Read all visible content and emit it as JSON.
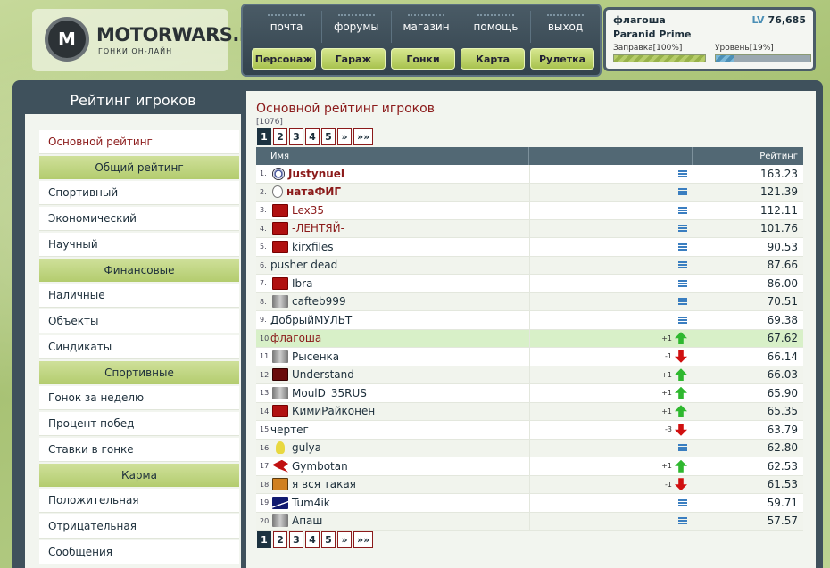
{
  "logo": {
    "name": "MOTORWARS.RU",
    "sub": "ГОНКИ ОН-ЛАЙН",
    "emblem": "M"
  },
  "topnav": [
    "почта",
    "форумы",
    "магазин",
    "помощь",
    "выход"
  ],
  "botnav": [
    "Персонаж",
    "Гараж",
    "Гонки",
    "Карта",
    "Рулетка"
  ],
  "user": {
    "name": "флагоша",
    "lv_label": "LV",
    "lv_value": "76,685",
    "car": "Paranid Prime",
    "fuel_label": "Заправка[100%]",
    "level_label": "Уровень[19%]",
    "fuel_fill": 1.0,
    "level_fill": 0.19
  },
  "sidebar": {
    "title": "Рейтинг игроков",
    "items": [
      {
        "type": "item",
        "label": "Основной рейтинг",
        "active": true
      },
      {
        "type": "head",
        "label": "Общий рейтинг"
      },
      {
        "type": "item",
        "label": "Спортивный"
      },
      {
        "type": "item",
        "label": "Экономический"
      },
      {
        "type": "item",
        "label": "Научный"
      },
      {
        "type": "head",
        "label": "Финансовые"
      },
      {
        "type": "item",
        "label": "Наличные"
      },
      {
        "type": "item",
        "label": "Объекты"
      },
      {
        "type": "item",
        "label": "Синдикаты"
      },
      {
        "type": "head",
        "label": "Спортивные"
      },
      {
        "type": "item",
        "label": "Гонок за неделю"
      },
      {
        "type": "item",
        "label": "Процент побед"
      },
      {
        "type": "item",
        "label": "Ставки в гонке"
      },
      {
        "type": "head",
        "label": "Карма"
      },
      {
        "type": "item",
        "label": "Положительная"
      },
      {
        "type": "item",
        "label": "Отрицательная"
      },
      {
        "type": "item",
        "label": "Сообщения"
      }
    ]
  },
  "content": {
    "title": "Основной рейтинг игроков",
    "count": "[1076]",
    "pager": [
      "1",
      "2",
      "3",
      "4",
      "5",
      "»",
      "»»"
    ],
    "columns": {
      "name": "Имя",
      "rating": "Рейтинг"
    },
    "rows": [
      {
        "rank": "1.",
        "avatar": "wheel",
        "name": "Justynuel",
        "red": true,
        "bold": true,
        "trend": "stat",
        "delta": "",
        "rating": "163.23"
      },
      {
        "rank": "2.",
        "avatar": "ring",
        "name": "натаФИГ",
        "red": true,
        "bold": true,
        "trend": "stat",
        "delta": "",
        "rating": "121.39"
      },
      {
        "rank": "3.",
        "avatar": "flag",
        "name": "Lex35",
        "red": true,
        "bold": false,
        "trend": "stat",
        "delta": "",
        "rating": "112.11"
      },
      {
        "rank": "4.",
        "avatar": "flag",
        "name": "-ЛЕНТЯЙ-",
        "red": true,
        "bold": false,
        "trend": "stat",
        "delta": "",
        "rating": "101.76"
      },
      {
        "rank": "5.",
        "avatar": "flag",
        "name": "kirxfiles",
        "red": false,
        "bold": false,
        "trend": "stat",
        "delta": "",
        "rating": "90.53"
      },
      {
        "rank": "6.",
        "avatar": "",
        "name": "pusher dead",
        "red": false,
        "bold": false,
        "trend": "stat",
        "delta": "",
        "rating": "87.66"
      },
      {
        "rank": "7.",
        "avatar": "flag",
        "name": "Ibra",
        "red": false,
        "bold": false,
        "trend": "stat",
        "delta": "",
        "rating": "86.00"
      },
      {
        "rank": "8.",
        "avatar": "gray",
        "name": "cafteb999",
        "red": false,
        "bold": false,
        "trend": "stat",
        "delta": "",
        "rating": "70.51"
      },
      {
        "rank": "9.",
        "avatar": "",
        "name": "ДобрыйМУЛЬТ",
        "red": false,
        "bold": false,
        "trend": "stat",
        "delta": "",
        "rating": "69.38"
      },
      {
        "rank": "10.",
        "avatar": "",
        "name": "флагоша",
        "red": true,
        "bold": false,
        "trend": "up",
        "delta": "+1",
        "rating": "67.62",
        "me": true
      },
      {
        "rank": "11.",
        "avatar": "gray",
        "name": "Рысенка",
        "red": false,
        "bold": false,
        "trend": "down",
        "delta": "-1",
        "rating": "66.14"
      },
      {
        "rank": "12.",
        "avatar": "dark",
        "name": "Understand",
        "red": false,
        "bold": false,
        "trend": "up",
        "delta": "+1",
        "rating": "66.03"
      },
      {
        "rank": "13.",
        "avatar": "gray",
        "name": "MoulD_35RUS",
        "red": false,
        "bold": false,
        "trend": "up",
        "delta": "+1",
        "rating": "65.90"
      },
      {
        "rank": "14.",
        "avatar": "flag",
        "name": "КимиРайконен",
        "red": false,
        "bold": false,
        "trend": "up",
        "delta": "+1",
        "rating": "65.35"
      },
      {
        "rank": "15.",
        "avatar": "",
        "name": "чертег",
        "red": false,
        "bold": false,
        "trend": "down",
        "delta": "-3",
        "rating": "63.79"
      },
      {
        "rank": "16.",
        "avatar": "bulb",
        "name": "gulya",
        "red": false,
        "bold": false,
        "trend": "stat",
        "delta": "",
        "rating": "62.80"
      },
      {
        "rank": "17.",
        "avatar": "bird",
        "name": "Gymbotan",
        "red": false,
        "bold": false,
        "trend": "up",
        "delta": "+1",
        "rating": "62.53"
      },
      {
        "rank": "18.",
        "avatar": "face",
        "name": "я вся такая",
        "red": false,
        "bold": false,
        "trend": "down",
        "delta": "-1",
        "rating": "61.53"
      },
      {
        "rank": "19.",
        "avatar": "blue",
        "name": "Tum4ik",
        "red": false,
        "bold": false,
        "trend": "stat",
        "delta": "",
        "rating": "59.71"
      },
      {
        "rank": "20.",
        "avatar": "gray",
        "name": "Апаш",
        "red": false,
        "bold": false,
        "trend": "stat",
        "delta": "",
        "rating": "57.57"
      }
    ]
  }
}
